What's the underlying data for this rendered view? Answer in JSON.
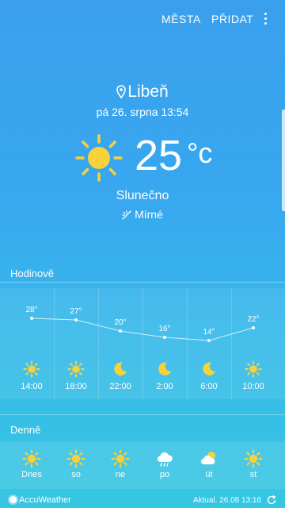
{
  "header": {
    "cities_label": "MĚSTA",
    "add_label": "PŘIDAT"
  },
  "current": {
    "location": "Libeň",
    "datetime": "pá 26. srpna 13:54",
    "temperature": "25",
    "unit": "°c",
    "condition": "Slunečno",
    "wind": "Mírné",
    "icon": "sun-icon"
  },
  "hourly": {
    "title": "Hodinově",
    "items": [
      {
        "time": "14:00",
        "temp": "28°",
        "icon": "sun-icon"
      },
      {
        "time": "18:00",
        "temp": "27°",
        "icon": "sun-icon"
      },
      {
        "time": "22:00",
        "temp": "20°",
        "icon": "moon-icon"
      },
      {
        "time": "2:00",
        "temp": "16°",
        "icon": "moon-icon"
      },
      {
        "time": "6:00",
        "temp": "14°",
        "icon": "moon-icon"
      },
      {
        "time": "10:00",
        "temp": "22°",
        "icon": "sun-icon"
      }
    ]
  },
  "daily": {
    "title": "Denně",
    "items": [
      {
        "day": "Dnes",
        "icon": "sun-icon"
      },
      {
        "day": "so",
        "icon": "sun-icon"
      },
      {
        "day": "ne",
        "icon": "sun-icon"
      },
      {
        "day": "po",
        "icon": "rain-cloud-icon"
      },
      {
        "day": "út",
        "icon": "partly-cloudy-icon"
      },
      {
        "day": "st",
        "icon": "sun-icon"
      }
    ]
  },
  "footer": {
    "brand": "AccuWeather",
    "updated": "Aktual. 26.08 13:16"
  },
  "colors": {
    "sun": "#f7d23a",
    "background_top": "#3aa0ee",
    "background_bottom": "#36c6e2"
  }
}
